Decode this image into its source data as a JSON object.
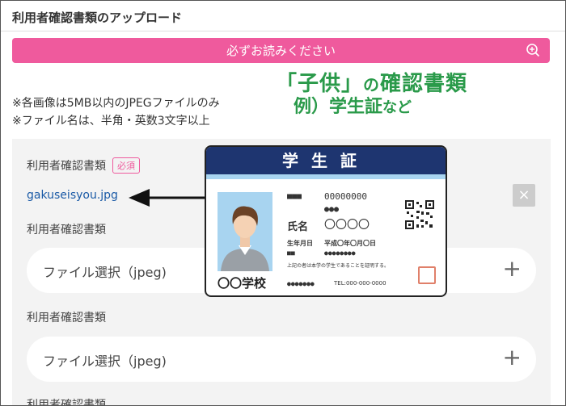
{
  "page": {
    "title": "利用者確認書類のアップロード",
    "notice_button": "必ずお読みください",
    "notes": [
      "※各画像は5MB以内のJPEGファイルのみ",
      "※ファイル名は、半角・英数3文字以上"
    ]
  },
  "callout": {
    "line1_open": "「子供」",
    "line1_mid": "の",
    "line1_end": "確認書類",
    "line2_main": "例）学生証",
    "line2_small": "など"
  },
  "form": {
    "fields": [
      {
        "label": "利用者確認書類",
        "required_badge": "必須",
        "file_name": "gakuseisyou.jpg",
        "remove": "×"
      },
      {
        "label": "利用者確認書類",
        "select_label": "ファイル選択（jpeg)"
      },
      {
        "label": "利用者確認書類",
        "select_label": "ファイル選択（jpeg)"
      },
      {
        "label": "利用者確認書類"
      }
    ],
    "plus": "+"
  },
  "id_card": {
    "header": "学生証",
    "number_label": "■■■",
    "number": "00000000",
    "name_kana": "●●●",
    "name_label": "氏名",
    "name_value": "〇〇〇〇",
    "dob_label": "生年月日",
    "dob_value": "平成〇年〇月〇日",
    "addr_label": "■■",
    "addr_value": "●●●●●●●●",
    "certify": "上記の者は本学の学生であることを証明する。",
    "school": "〇〇学校",
    "dots": "●●●●●●●",
    "tel": "TEL:000-000-0000"
  },
  "colors": {
    "accent_pink": "#ef5a9d",
    "callout_green": "#2a9a4a",
    "card_navy": "#1e3570",
    "link_blue": "#1a5aa6"
  }
}
